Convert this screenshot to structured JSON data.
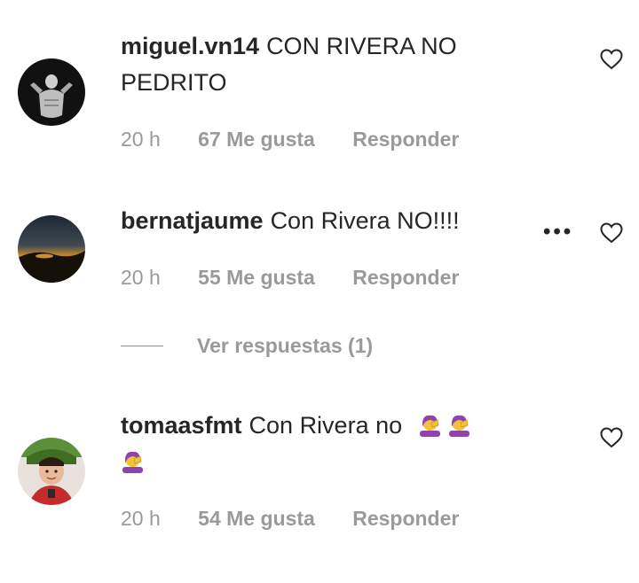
{
  "comments": [
    {
      "username": "miguel.vn14",
      "text": "CON RIVERA NO PEDRITO",
      "time": "20 h",
      "likes": "67 Me gusta",
      "reply": "Responder",
      "avatar": "black-white-photo"
    },
    {
      "username": "bernatjaume",
      "text": "Con Rivera NO!!!!",
      "time": "20 h",
      "likes": "55 Me gusta",
      "reply": "Responder",
      "more": "•••",
      "avatar": "sunset-landscape"
    },
    {
      "username": "tomaasfmt",
      "text": "Con Rivera no",
      "emoji": "woman-facepalming",
      "emoji_count": 3,
      "time": "20 h",
      "likes": "54 Me gusta",
      "reply": "Responder",
      "avatar": "child-portrait"
    }
  ],
  "view_replies": "Ver respuestas (1)",
  "colors": {
    "text": "#262626",
    "meta": "#9a9a9a",
    "heart": "#262626"
  },
  "icons": [
    "heart-icon",
    "more-options-icon",
    "woman-facepalming-emoji"
  ]
}
